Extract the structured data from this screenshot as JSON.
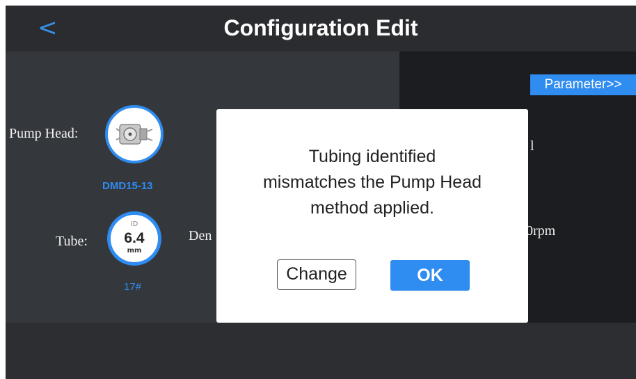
{
  "header": {
    "title": "Configuration Edit",
    "back_icon": "chevron-left-icon"
  },
  "pump_head": {
    "label": "Pump Head:",
    "model": "DMD15-13"
  },
  "tube": {
    "label": "Tube:",
    "id_caption": "ID",
    "size": "6.4",
    "unit": "mm",
    "code": "17#"
  },
  "partial_labels": {
    "density": "Den",
    "right_value_1": "l",
    "right_value_2": ".0rpm"
  },
  "parameter_button": "Parameter>>",
  "dialog": {
    "message_line1": "Tubing identified",
    "message_line2": "mismatches the Pump Head",
    "message_line3": "method applied.",
    "change_label": "Change",
    "ok_label": "OK"
  },
  "colors": {
    "accent": "#2f8cf0",
    "dialog_bg": "#ffffff",
    "panel_bg": "#34373b"
  }
}
